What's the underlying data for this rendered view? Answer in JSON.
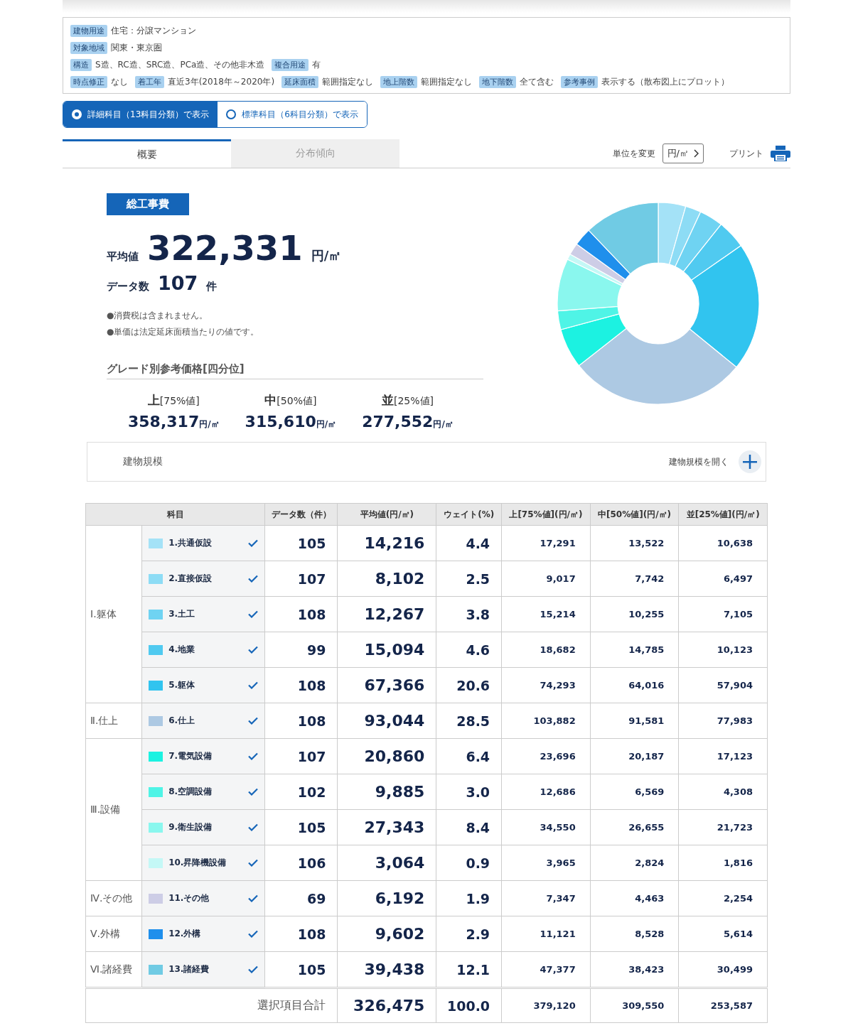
{
  "filters": [
    [
      {
        "tag": "建物用途",
        "value": "住宅：分譲マンション"
      }
    ],
    [
      {
        "tag": "対象地域",
        "value": "関東・東京圏"
      }
    ],
    [
      {
        "tag": "構造",
        "value": "S造、RC造、SRC造、PCa造、その他非木造"
      },
      {
        "tag": "複合用途",
        "value": "有"
      }
    ],
    [
      {
        "tag": "時点修正",
        "value": "なし"
      },
      {
        "tag": "着工年",
        "value": "直近3年(2018年～2020年)"
      },
      {
        "tag": "延床面積",
        "value": "範囲指定なし"
      },
      {
        "tag": "地上階数",
        "value": "範囲指定なし"
      },
      {
        "tag": "地下階数",
        "value": "全て含む"
      },
      {
        "tag": "参考事例",
        "value": "表示する（散布図上にプロット）"
      }
    ]
  ],
  "view_options": [
    {
      "label": "詳細科目（13科目分類）で表示",
      "selected": true
    },
    {
      "label": "標準科目（6科目分類）で表示",
      "selected": false
    }
  ],
  "tabs": [
    {
      "label": "概要",
      "selected": true
    },
    {
      "label": "分布傾向",
      "selected": false
    }
  ],
  "unit_label": "単位を変更",
  "unit": "円/㎡",
  "print_label": "プリント",
  "summary": {
    "badge": "総工事費",
    "avg_label": "平均値",
    "avg_value": "322,331",
    "avg_unit": "円/㎡",
    "count_label": "データ数",
    "count_value": "107",
    "count_unit": "件",
    "notes": [
      "●消費税は含まれません。",
      "●単価は法定延床面積当たりの値です。"
    ],
    "grade_title": "グレード別参考価格[四分位]",
    "grades": [
      {
        "grade": "上",
        "pct": "[75%値]",
        "value": "358,317",
        "unit": "円/㎡"
      },
      {
        "grade": "中",
        "pct": "[50%値]",
        "value": "315,610",
        "unit": "円/㎡"
      },
      {
        "grade": "並",
        "pct": "[25%値]",
        "value": "277,552",
        "unit": "円/㎡"
      }
    ]
  },
  "building_scale": {
    "title": "建物規模",
    "open_label": "建物規模を開く",
    "expanded": false
  },
  "table": {
    "columns": [
      "科目",
      "データ数（件）",
      "平均値(円/㎡)",
      "ウェイト(%)",
      "上[75%値](円/㎡)",
      "中[50%値](円/㎡)",
      "並[25%値](円/㎡)"
    ],
    "groups": [
      {
        "label": "Ⅰ.躯体",
        "items": [
          {
            "name": "1.共通仮設",
            "color": "#a4e2f7",
            "checked": true,
            "count": "105",
            "avg": "14,216",
            "weight": "4.4",
            "q75": "17,291",
            "q50": "13,522",
            "q25": "10,638"
          },
          {
            "name": "2.直接仮設",
            "color": "#8ddcf5",
            "checked": true,
            "count": "107",
            "avg": "8,102",
            "weight": "2.5",
            "q75": "9,017",
            "q50": "7,742",
            "q25": "6,497"
          },
          {
            "name": "3.土工",
            "color": "#6fd3f2",
            "checked": true,
            "count": "108",
            "avg": "12,267",
            "weight": "3.8",
            "q75": "15,214",
            "q50": "10,255",
            "q25": "7,105"
          },
          {
            "name": "4.地業",
            "color": "#50caf0",
            "checked": true,
            "count": "99",
            "avg": "15,094",
            "weight": "4.6",
            "q75": "18,682",
            "q50": "14,785",
            "q25": "10,123"
          },
          {
            "name": "5.躯体",
            "color": "#31c4ef",
            "checked": true,
            "count": "108",
            "avg": "67,366",
            "weight": "20.6",
            "q75": "74,293",
            "q50": "64,016",
            "q25": "57,904"
          }
        ]
      },
      {
        "label": "Ⅱ.仕上",
        "items": [
          {
            "name": "6.仕上",
            "color": "#adc9e3",
            "checked": true,
            "count": "108",
            "avg": "93,044",
            "weight": "28.5",
            "q75": "103,882",
            "q50": "91,581",
            "q25": "77,983"
          }
        ]
      },
      {
        "label": "Ⅲ.設備",
        "items": [
          {
            "name": "7.電気設備",
            "color": "#1cf2e1",
            "checked": true,
            "count": "107",
            "avg": "20,860",
            "weight": "6.4",
            "q75": "23,696",
            "q50": "20,187",
            "q25": "17,123"
          },
          {
            "name": "8.空調設備",
            "color": "#4ff4e6",
            "checked": true,
            "count": "102",
            "avg": "9,885",
            "weight": "3.0",
            "q75": "12,686",
            "q50": "6,569",
            "q25": "4,308"
          },
          {
            "name": "9.衛生設備",
            "color": "#8af7ee",
            "checked": true,
            "count": "105",
            "avg": "27,343",
            "weight": "8.4",
            "q75": "34,550",
            "q50": "26,655",
            "q25": "21,723"
          },
          {
            "name": "10.昇降機設備",
            "color": "#c4f8f6",
            "checked": true,
            "count": "106",
            "avg": "3,064",
            "weight": "0.9",
            "q75": "3,965",
            "q50": "2,824",
            "q25": "1,816"
          }
        ]
      },
      {
        "label": "Ⅳ.その他",
        "items": [
          {
            "name": "11.その他",
            "color": "#cdcde6",
            "checked": true,
            "count": "69",
            "avg": "6,192",
            "weight": "1.9",
            "q75": "7,347",
            "q50": "4,463",
            "q25": "2,254"
          }
        ]
      },
      {
        "label": "Ⅴ.外構",
        "items": [
          {
            "name": "12.外構",
            "color": "#1f8fec",
            "checked": true,
            "count": "108",
            "avg": "9,602",
            "weight": "2.9",
            "q75": "11,121",
            "q50": "8,528",
            "q25": "5,614"
          }
        ]
      },
      {
        "label": "Ⅵ.諸経費",
        "items": [
          {
            "name": "13.諸経費",
            "color": "#70cbe4",
            "checked": true,
            "count": "105",
            "avg": "39,438",
            "weight": "12.1",
            "q75": "47,377",
            "q50": "38,423",
            "q25": "30,499"
          }
        ]
      }
    ],
    "total": {
      "label": "選択項目合計",
      "avg": "326,475",
      "weight": "100.0",
      "q75": "379,120",
      "q50": "309,550",
      "q25": "253,587"
    }
  }
}
